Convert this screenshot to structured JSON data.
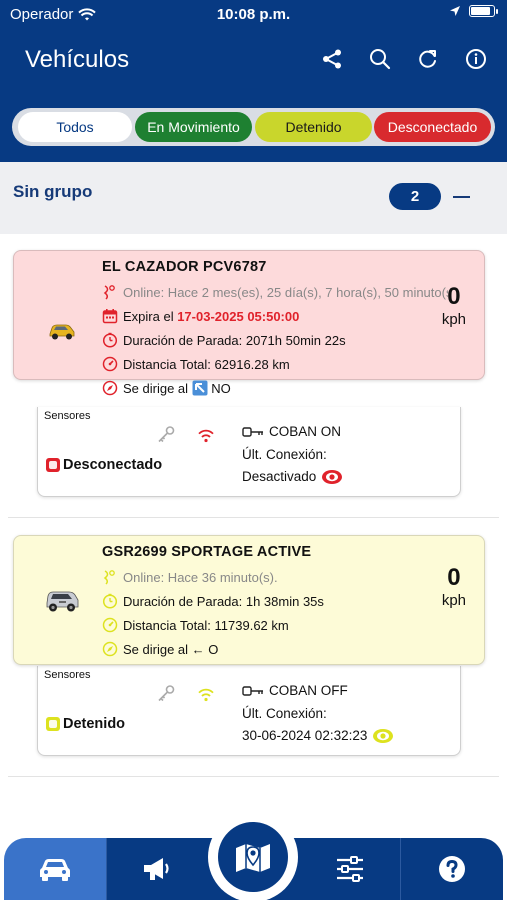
{
  "status_bar": {
    "carrier": "Operador",
    "time": "10:08 p.m."
  },
  "header": {
    "title": "Vehículos",
    "icons": [
      "share-icon",
      "search-icon",
      "refresh-icon",
      "info-icon"
    ]
  },
  "filters": {
    "all": "Todos",
    "moving": "En Movimiento",
    "stopped": "Detenido",
    "disconnected": "Desconectado"
  },
  "group": {
    "title": "Sin grupo",
    "count": "2"
  },
  "vehicles": [
    {
      "name": "EL CAZADOR PCV6787",
      "online": "Online: Hace 2 mes(es), 25 día(s), 7 hora(s), 50 minuto(s).",
      "expires_label": "Expira el",
      "expires_value": "17-03-2025 05:50:00",
      "stop_duration": "Duración de Parada: 2071h 50min 22s",
      "total_distance": "Distancia Total: 62916.28 km",
      "heading_label": "Se dirige al",
      "heading_value": "NO",
      "speed": "0",
      "speed_unit": "kph",
      "sensors_label": "Sensores",
      "state": "Desconectado",
      "device": "COBAN ON",
      "last_conn_label": "Últ. Conexión:",
      "last_conn_value": "Desactivado",
      "colors": {
        "card": "#fddadb",
        "accent": "#e0222b"
      }
    },
    {
      "name": "GSR2699 SPORTAGE ACTIVE",
      "online": "Online: Hace 36 minuto(s).",
      "stop_duration": "Duración de Parada: 1h 38min 35s",
      "total_distance": "Distancia Total: 11739.62 km",
      "heading_label": "Se dirige al",
      "heading_value": "← O",
      "speed": "0",
      "speed_unit": "kph",
      "sensors_label": "Sensores",
      "state": "Detenido",
      "device": "COBAN OFF",
      "last_conn_label": "Últ. Conexión:",
      "last_conn_value": "30-06-2024 02:32:23",
      "colors": {
        "card": "#fdfbd7",
        "accent": "#dde21f"
      }
    }
  ],
  "tabbar": {
    "icons": [
      "car-icon",
      "megaphone-icon",
      "map-icon",
      "sliders-icon",
      "help-icon"
    ]
  },
  "colors": {
    "primary": "#073a83",
    "moving": "#1e8031",
    "stopped": "#c9d62c",
    "disconnected": "#d82a2e"
  }
}
